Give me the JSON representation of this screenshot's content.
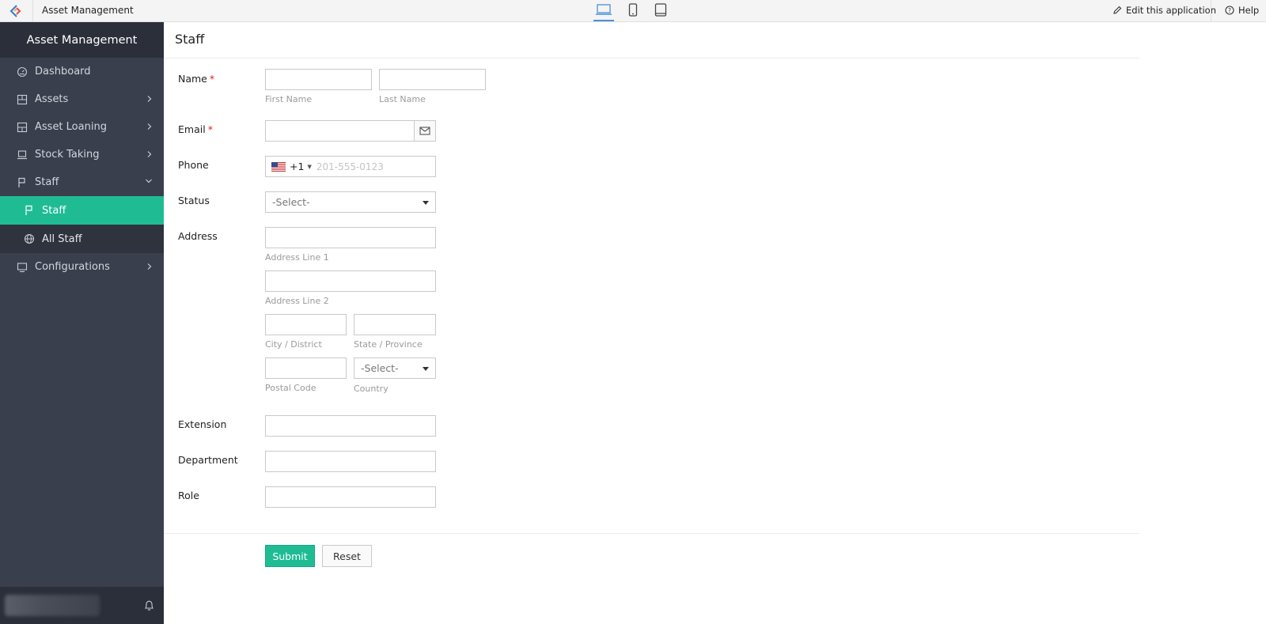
{
  "topbar": {
    "logo_icon": "zoho-creator-logo-icon",
    "app_name": "Asset Management",
    "devices": [
      "laptop-icon",
      "mobile-icon",
      "tablet-icon"
    ],
    "edit_label": "Edit this application",
    "help_label": "Help"
  },
  "sidebar": {
    "title": "Asset Management",
    "items": [
      {
        "label": "Dashboard",
        "icon": "dashboard-icon"
      },
      {
        "label": "Assets",
        "icon": "assets-icon"
      },
      {
        "label": "Asset Loaning",
        "icon": "asset-loaning-icon"
      },
      {
        "label": "Stock Taking",
        "icon": "stock-taking-icon"
      },
      {
        "label": "Staff",
        "icon": "flag-icon"
      }
    ],
    "sub_items": [
      {
        "label": "Staff",
        "icon": "flag-icon",
        "active": true
      },
      {
        "label": "All Staff",
        "icon": "globe-icon",
        "active": false
      }
    ],
    "last_item": {
      "label": "Configurations",
      "icon": "monitor-icon"
    },
    "accent_color": "#1fbc94"
  },
  "form": {
    "title": "Staff",
    "name_label": "Name",
    "first_name_hint": "First Name",
    "last_name_hint": "Last Name",
    "email_label": "Email",
    "required_mark": "*",
    "phone_label": "Phone",
    "phone_code": "+1",
    "phone_placeholder": "201-555-0123",
    "status_label": "Status",
    "status_value": "-Select-",
    "address_label": "Address",
    "address_line1_hint": "Address Line 1",
    "address_line2_hint": "Address Line 2",
    "city_hint": "City / District",
    "state_hint": "State / Province",
    "postal_hint": "Postal Code",
    "country_hint": "Country",
    "country_value": "-Select-",
    "extension_label": "Extension",
    "department_label": "Department",
    "role_label": "Role",
    "submit_label": "Submit",
    "reset_label": "Reset"
  }
}
